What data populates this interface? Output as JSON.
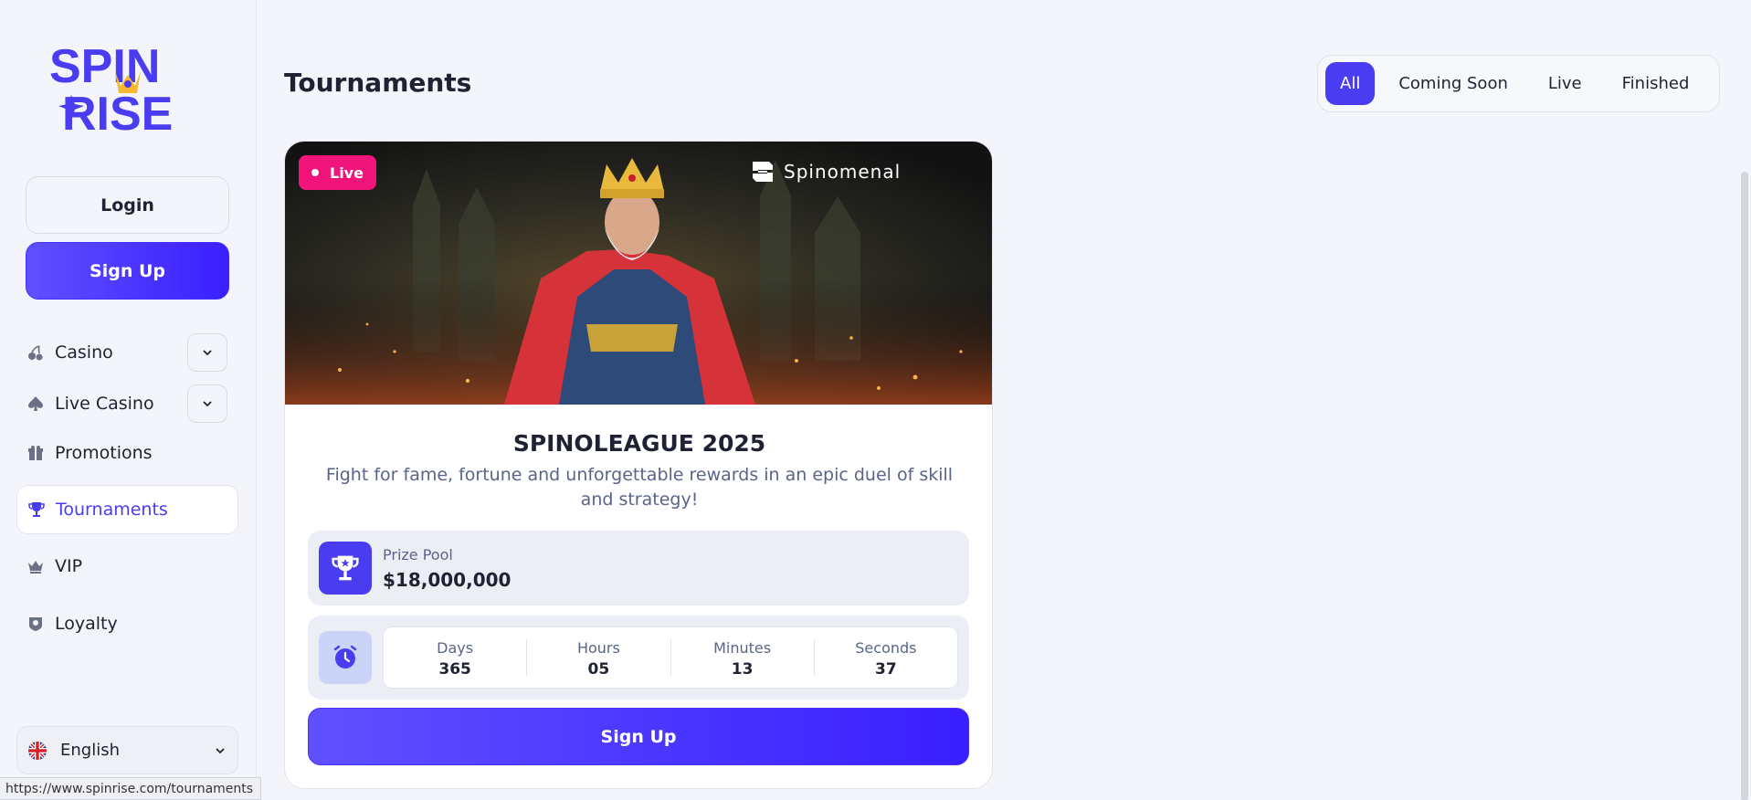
{
  "sidebar": {
    "logo_top": "SPIN",
    "logo_bottom": "RISE",
    "login_label": "Login",
    "signup_label": "Sign Up",
    "nav": [
      {
        "label": "Casino",
        "icon": "cherry-icon",
        "expandable": true
      },
      {
        "label": "Live Casino",
        "icon": "spade-icon",
        "expandable": true
      },
      {
        "label": "Promotions",
        "icon": "gift-icon",
        "expandable": false
      },
      {
        "label": "Tournaments",
        "icon": "trophy-icon",
        "expandable": false,
        "active": true
      },
      {
        "label": "VIP",
        "icon": "crown-icon",
        "expandable": false
      },
      {
        "label": "Loyalty",
        "icon": "badge-icon",
        "expandable": false
      }
    ],
    "language": "English"
  },
  "status_url": "https://www.spinrise.com/tournaments",
  "main": {
    "title": "Tournaments",
    "filters": [
      "All",
      "Coming Soon",
      "Live",
      "Finished"
    ],
    "active_filter": "All"
  },
  "tournament": {
    "badge": "Live",
    "provider": "Spinomenal",
    "title": "SPINOLEAGUE 2025",
    "description": "Fight for fame, fortune and unforgettable rewards in an epic duel of skill and strategy!",
    "prize_label": "Prize Pool",
    "prize_value": "$18,000,000",
    "timer": [
      {
        "label": "Days",
        "value": "365"
      },
      {
        "label": "Hours",
        "value": "05"
      },
      {
        "label": "Minutes",
        "value": "13"
      },
      {
        "label": "Seconds",
        "value": "37"
      }
    ],
    "cta_label": "Sign Up"
  },
  "colors": {
    "accent": "#4a3cf0",
    "live_badge": "#f0147b",
    "background": "#f4f5fa",
    "logo_gold": "#f5b82e"
  }
}
